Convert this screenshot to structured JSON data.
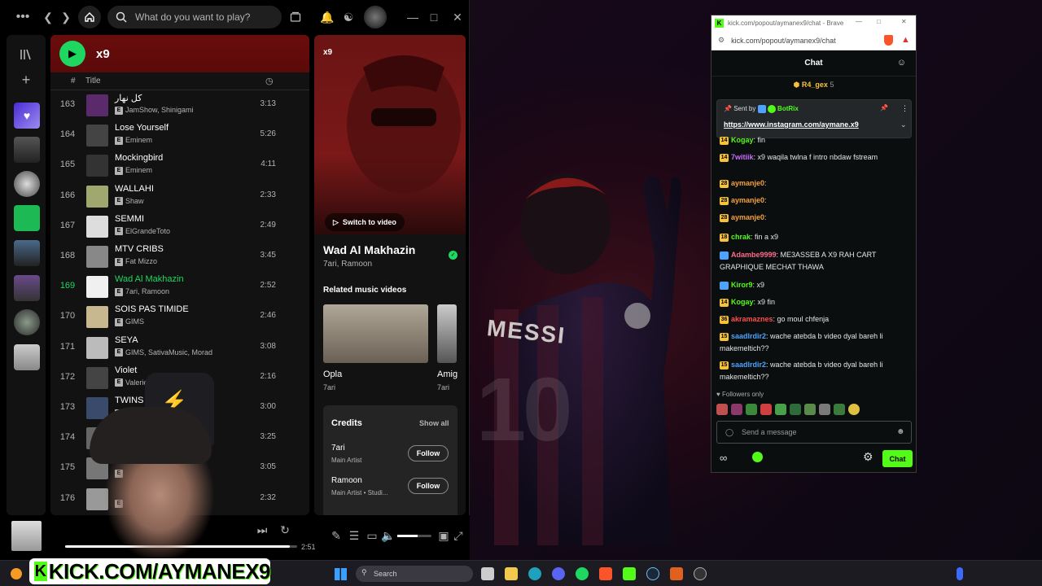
{
  "spotify": {
    "search_placeholder": "What do you want to play?",
    "playlist_title": "x9",
    "col_num": "#",
    "col_title": "Title",
    "tracks": [
      {
        "n": "163",
        "title": "كل نهار",
        "artists": "JamShow, Shinigami",
        "dur": "3:13"
      },
      {
        "n": "164",
        "title": "Lose Yourself",
        "artists": "Eminem",
        "dur": "5:26"
      },
      {
        "n": "165",
        "title": "Mockingbird",
        "artists": "Eminem",
        "dur": "4:11"
      },
      {
        "n": "166",
        "title": "WALLAHI",
        "artists": "Shaw",
        "dur": "2:33"
      },
      {
        "n": "167",
        "title": "SEMMI",
        "artists": "ElGrandeToto",
        "dur": "2:49"
      },
      {
        "n": "168",
        "title": "MTV CRIBS",
        "artists": "Fat Mizzo",
        "dur": "3:45"
      },
      {
        "n": "169",
        "title": "Wad Al Makhazin",
        "artists": "7ari, Ramoon",
        "dur": "2:52"
      },
      {
        "n": "170",
        "title": "SOIS PAS TIMIDE",
        "artists": "GIMS",
        "dur": "2:46"
      },
      {
        "n": "171",
        "title": "SEYA",
        "artists": "GIMS, SativaMusic, Morad",
        "dur": "3:08"
      },
      {
        "n": "172",
        "title": "Violet",
        "artists": "Valerieb",
        "dur": "2:16"
      },
      {
        "n": "173",
        "title": "TWINS",
        "artists": "",
        "dur": "3:00"
      },
      {
        "n": "174",
        "title": "",
        "artists": "",
        "dur": "3:25"
      },
      {
        "n": "175",
        "title": "",
        "artists": "",
        "dur": "3:05"
      },
      {
        "n": "176",
        "title": "",
        "artists": "",
        "dur": "2:32"
      }
    ],
    "explicit_badge": "E",
    "right_panel": {
      "title": "x9",
      "switch_to_video": "Switch to video",
      "song": "Wad Al Makhazin",
      "artists": "7ari, Ramoon",
      "related_heading": "Related music videos",
      "videos": [
        {
          "title": "Opla",
          "artist": "7ari"
        },
        {
          "title": "Amig",
          "artist": "7ari"
        }
      ],
      "credits_heading": "Credits",
      "show_all": "Show all",
      "credits": [
        {
          "name": "7ari",
          "role": "Main Artist",
          "action": "Follow"
        },
        {
          "name": "Ramoon",
          "role": "Main Artist • Studi...",
          "action": "Follow"
        }
      ]
    },
    "now_playing": {
      "time_total": "2:51",
      "progress": 0.97,
      "volume": 0.6
    }
  },
  "browser": {
    "title": "kick.com/popout/aymanex9/chat - Brave",
    "url": "kick.com/popout/aymanex9/chat",
    "chat_heading": "Chat",
    "top_gifter": {
      "name": "R4_gex",
      "count": "5"
    },
    "pinned": {
      "sent_by_label": "Sent by",
      "sender": "BotRix",
      "link": "https://www.instagram.com/aymane.x9"
    },
    "messages": [
      {
        "badge": "14",
        "user": "Kogay",
        "color": "#53fc18",
        "text": ": fin"
      },
      {
        "badge": "14",
        "user": "7witiik",
        "color": "#c86dff",
        "text": ": x9 waqila twlna f intro nbdaw fstream"
      },
      {
        "badge": "28",
        "user": "aymanje0",
        "color": "#f7a13a",
        "text": ":"
      },
      {
        "badge": "28",
        "user": "aymanje0",
        "color": "#f7a13a",
        "text": ":"
      },
      {
        "badge": "28",
        "user": "aymanje0",
        "color": "#f7a13a",
        "text": ":"
      },
      {
        "badge": "18",
        "user": "chrak",
        "color": "#53fc18",
        "text": ": fin a x9"
      },
      {
        "badge": "",
        "user": "Adambe9999",
        "color": "#ff6b8a",
        "text": ": ME3ASSEB A X9 RAH CART GRAPHIQUE MECHAT THAWA"
      },
      {
        "badge": "",
        "user": "Kiror9",
        "color": "#53fc18",
        "text": ": x9"
      },
      {
        "badge": "14",
        "user": "Kogay",
        "color": "#53fc18",
        "text": ": x9 fin"
      },
      {
        "badge": "36",
        "user": "akramaznes",
        "color": "#ff4d4d",
        "text": ": go moul chfenja"
      },
      {
        "badge": "15",
        "user": "saadlrdir2",
        "color": "#4da3ff",
        "text": ": wache atebda b video dyal bareh li makemeltich??"
      },
      {
        "badge": "15",
        "user": "saadlrdir2",
        "color": "#4da3ff",
        "text": ": wache atebda b video dyal bareh li makemeltich??"
      }
    ],
    "followers_only": "Followers only",
    "input_placeholder": "Send a message",
    "send_label": "Chat"
  },
  "desktop": {
    "jersey_text": "MESSI"
  },
  "taskbar": {
    "search_placeholder": "Search"
  },
  "overlay": {
    "banner_text": "KICK.COM/AYMANEX9"
  },
  "colors": {
    "spotify_green": "#1ed760",
    "kick_green": "#53fc18",
    "header_red": "#6b0c0c"
  }
}
